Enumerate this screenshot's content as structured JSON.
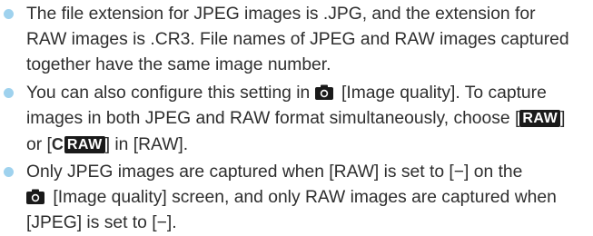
{
  "notes": [
    {
      "lines": [
        "The file extension for JPEG images is .JPG, and the extension for",
        "RAW images is .CR3. File names of JPEG and RAW images captured",
        "together have the same image number."
      ]
    },
    {
      "line1_pre": "You can also configure this setting in ",
      "line1_icon": "camera-shooting-icon",
      "line1_post": " [Image quality]. To capture",
      "line2_pre": "images in both JPEG and RAW format simultaneously, choose [",
      "raw_badge": "RAW",
      "line2_post": "]",
      "line3_pre": "or [",
      "c_mark": "C",
      "craw_badge": "RAW",
      "line3_post": "] in [RAW]."
    },
    {
      "line1": "Only JPEG images are captured when [RAW] is set to [−] on the",
      "line2_icon": "camera-shooting-icon",
      "line2_post": " [Image quality] screen, and only RAW images are captured when",
      "line3": "[JPEG] is set to [−]."
    }
  ],
  "colors": {
    "bullet": "#9fd2ee",
    "text": "#2e2e2e",
    "badge_bg": "#1a1a1a"
  }
}
